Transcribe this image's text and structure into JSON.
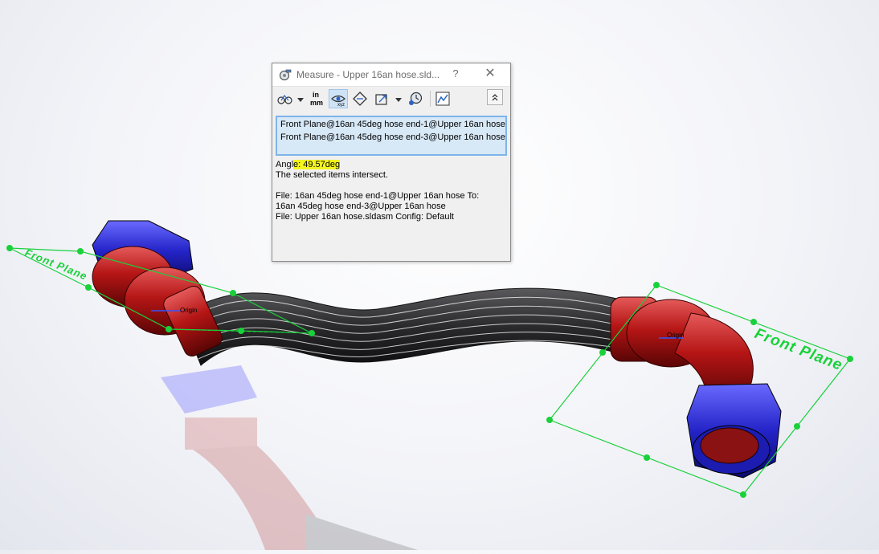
{
  "dialog": {
    "title": "Measure - Upper 16an hose.sld...",
    "help_label": "?",
    "close_label": "✕",
    "toolbar": {
      "items": [
        {
          "icon": "arc-circle-measure-icon"
        },
        {
          "icon": "units-precision-icon",
          "label_top": "in",
          "label_bottom": "mm"
        },
        {
          "icon": "show-xyz-measurements-icon",
          "active": true
        },
        {
          "icon": "point-to-point-icon"
        },
        {
          "icon": "projection-icon"
        },
        {
          "icon": "measurement-history-icon"
        },
        {
          "icon": "create-sensor-icon"
        }
      ]
    },
    "selections": [
      "Front Plane@16an 45deg hose end-1@Upper 16an hose",
      "Front Plane@16an 45deg hose end-3@Upper 16an hose"
    ],
    "results": {
      "angle_prefix": "Angl",
      "angle_highlight": "e: 49.57deg",
      "intersect": "The selected items intersect.",
      "file_line1": "File: 16an 45deg hose end-1@Upper 16an hose To:",
      "file_line2": "16an 45deg hose end-3@Upper 16an hose",
      "file_line3": "File: Upper 16an hose.sldasm Config: Default"
    }
  },
  "viewport": {
    "right_plane_label": "Front Plane",
    "left_plane_label": "Front Plane",
    "origin_label_left": "Origin",
    "origin_label_right": "Origin",
    "colors": {
      "plane": "#19d13a",
      "fitting_red": "#b41414",
      "fitting_blue": "#2626c9",
      "hose": "#2b2b2d",
      "highlight": "#f3f520"
    }
  }
}
